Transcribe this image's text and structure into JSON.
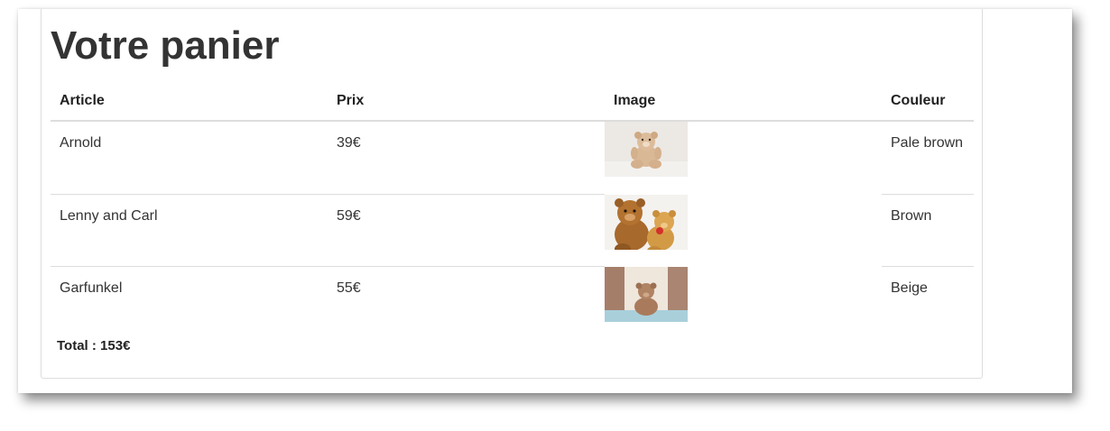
{
  "page": {
    "title": "Votre panier"
  },
  "table": {
    "headers": [
      "Article",
      "Prix",
      "Image",
      "Couleur"
    ],
    "rows": [
      {
        "article": "Arnold",
        "prix": "39€",
        "image": "teddy-bear-single-icon",
        "couleur": "Pale brown"
      },
      {
        "article": "Lenny and Carl",
        "prix": "59€",
        "image": "teddy-bear-pair-icon",
        "couleur": "Brown"
      },
      {
        "article": "Garfunkel",
        "prix": "55€",
        "image": "teddy-bear-window-icon",
        "couleur": "Beige"
      }
    ]
  },
  "total": {
    "label": "Total : 153€"
  },
  "colors": {
    "text": "#333333",
    "border": "#dddddd",
    "background": "#ffffff"
  }
}
